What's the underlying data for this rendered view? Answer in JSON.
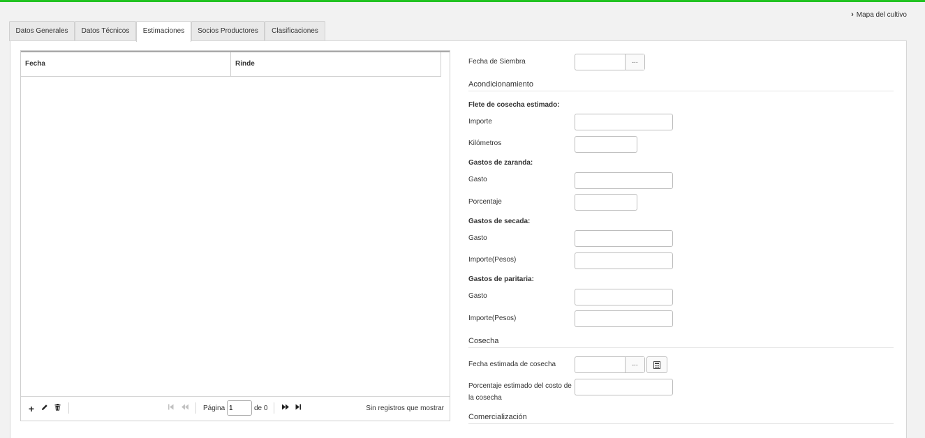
{
  "header": {
    "map_link": "Mapa del cultivo"
  },
  "tabs": [
    {
      "label": "Datos Generales"
    },
    {
      "label": "Datos Técnicos"
    },
    {
      "label": "Estimaciones"
    },
    {
      "label": "Socios Productores"
    },
    {
      "label": "Clasificaciones"
    }
  ],
  "active_tab": "Estimaciones",
  "grid": {
    "columns": [
      "Fecha",
      "Rinde"
    ],
    "rows": [],
    "pager": {
      "page_label": "Página",
      "page_value": "1",
      "of_label": "de 0",
      "empty_message": "Sin registros que mostrar"
    }
  },
  "form": {
    "fecha_siembra": {
      "label": "Fecha de Siembra",
      "value": "",
      "button": "..."
    },
    "acondicionamiento": "Acondicionamiento",
    "flete": {
      "title": "Flete de cosecha estimado:",
      "importe_label": "Importe",
      "km_label": "Kilómetros"
    },
    "zaranda": {
      "title": "Gastos de zaranda:",
      "gasto_label": "Gasto",
      "porcentaje_label": "Porcentaje"
    },
    "secada": {
      "title": "Gastos de secada:",
      "gasto_label": "Gasto",
      "importe_label": "Importe(Pesos)"
    },
    "paritaria": {
      "title": "Gastos de paritaria:",
      "gasto_label": "Gasto",
      "importe_label": "Importe(Pesos)"
    },
    "cosecha": {
      "title": "Cosecha",
      "fecha_label": "Fecha estimada de cosecha",
      "fecha_button": "...",
      "porcentaje_label_1": "Porcentaje estimado del costo de",
      "porcentaje_label_2": "la cosecha"
    },
    "comercializacion": "Comercialización"
  }
}
